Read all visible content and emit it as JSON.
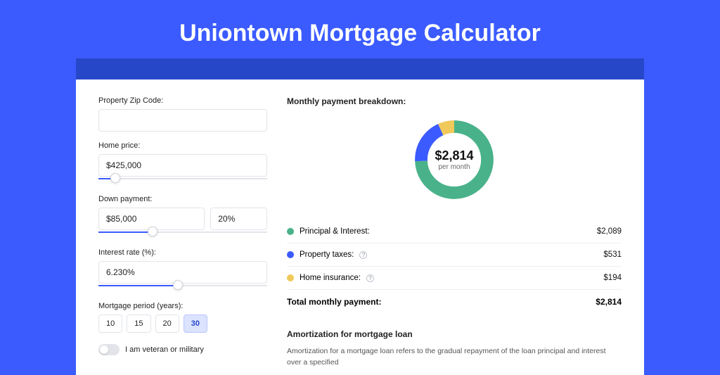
{
  "title": "Uniontown Mortgage Calculator",
  "form": {
    "zip_label": "Property Zip Code:",
    "zip_value": "",
    "home_price_label": "Home price:",
    "home_price_value": "$425,000",
    "home_price_slider_pct": 10,
    "down_payment_label": "Down payment:",
    "down_payment_value": "$85,000",
    "down_payment_pct_value": "20%",
    "down_payment_slider_pct": 32,
    "interest_label": "Interest rate (%):",
    "interest_value": "6.230%",
    "interest_slider_pct": 47,
    "period_label": "Mortgage period (years):",
    "periods": [
      "10",
      "15",
      "20",
      "30"
    ],
    "period_selected": "30",
    "veteran_label": "I am veteran or military"
  },
  "breakdown": {
    "title": "Monthly payment breakdown:",
    "main_amount": "$2,814",
    "sub": "per month",
    "items": [
      {
        "color": "g",
        "label": "Principal & Interest:",
        "info": false,
        "value": "$2,089"
      },
      {
        "color": "b",
        "label": "Property taxes:",
        "info": true,
        "value": "$531"
      },
      {
        "color": "y",
        "label": "Home insurance:",
        "info": true,
        "value": "$194"
      }
    ],
    "total_label": "Total monthly payment:",
    "total_value": "$2,814"
  },
  "chart_data": {
    "type": "pie",
    "title": "Monthly payment breakdown",
    "series": [
      {
        "name": "Principal & Interest",
        "value": 2089,
        "color": "#49b28a"
      },
      {
        "name": "Property taxes",
        "value": 531,
        "color": "#3b5bff"
      },
      {
        "name": "Home insurance",
        "value": 194,
        "color": "#f0c95a"
      }
    ],
    "total": 2814,
    "center_label": "$2,814 per month"
  },
  "amort": {
    "title": "Amortization for mortgage loan",
    "text": "Amortization for a mortgage loan refers to the gradual repayment of the loan principal and interest over a specified"
  }
}
